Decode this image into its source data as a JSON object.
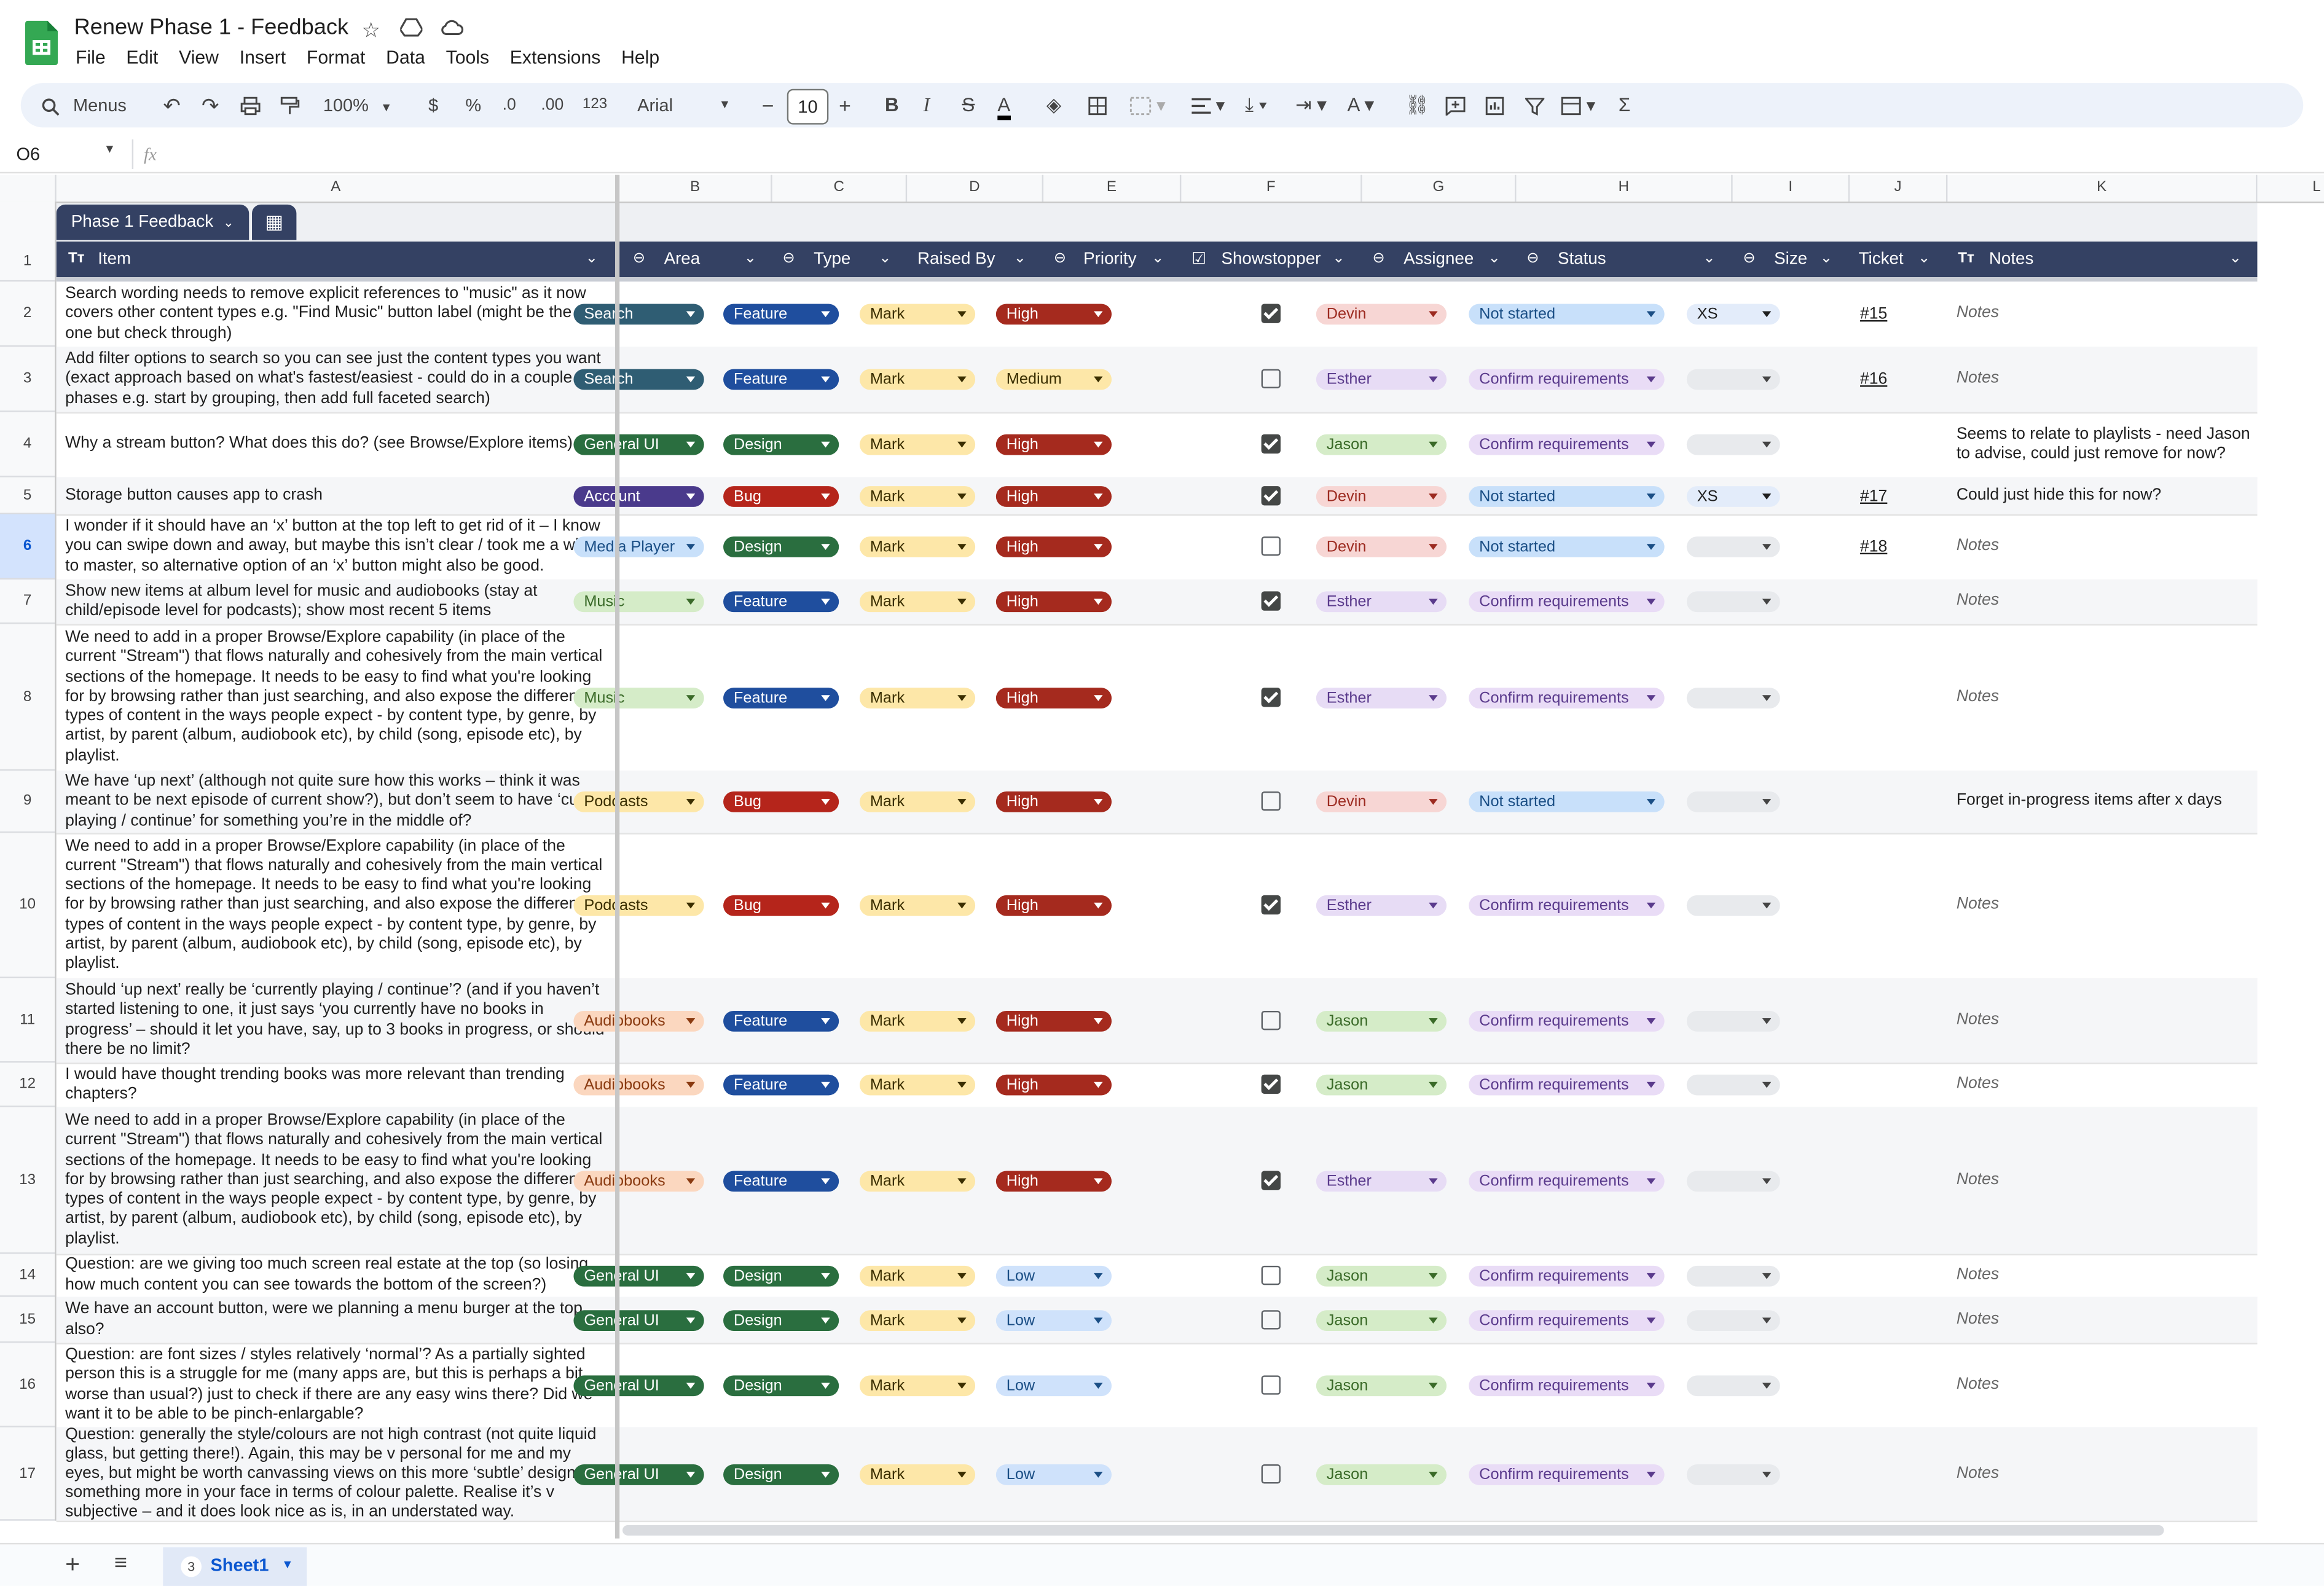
{
  "title": "Renew Phase 1 - Feedback",
  "menu": [
    "File",
    "Edit",
    "View",
    "Insert",
    "Format",
    "Data",
    "Tools",
    "Extensions",
    "Help"
  ],
  "toolbar": {
    "search_label": "Menus",
    "zoom": "100%",
    "currency": "$",
    "percent": "%",
    "dec_less": ".0",
    "dec_more": ".00",
    "fmt_123": "123",
    "font": "Arial",
    "font_size": "10"
  },
  "formula_bar": {
    "cell_ref": "O6",
    "fx": "fx",
    "value": ""
  },
  "columns": [
    "A",
    "B",
    "C",
    "D",
    "E",
    "F",
    "G",
    "H",
    "I",
    "J",
    "K",
    "L"
  ],
  "table": {
    "name": "Phase 1 Feedback",
    "headers": {
      "item": "Item",
      "area": "Area",
      "type": "Type",
      "raised_by": "Raised By",
      "priority": "Priority",
      "showstopper": "Showstopper",
      "assignee": "Assignee",
      "status": "Status",
      "size": "Size",
      "ticket": "Ticket",
      "notes": "Notes"
    }
  },
  "row_numbers": [
    "1",
    "2",
    "3",
    "4",
    "5",
    "6",
    "7",
    "8",
    "9",
    "10",
    "11",
    "12",
    "13",
    "14",
    "15",
    "16",
    "17"
  ],
  "rows": [
    {
      "num": "2",
      "item": "Search wording needs to remove explicit references to \"music\" as it now covers other content types e.g. \"Find Music\" button label (might be the only one but check through)",
      "area": "Search",
      "type": "Feature",
      "raised_by": "Mark",
      "priority": "High",
      "showstopper": true,
      "assignee": "Devin",
      "status": "Not started",
      "size": "XS",
      "ticket": "#15",
      "notes": "Notes",
      "notes_placeholder": true
    },
    {
      "num": "3",
      "item": "Add filter options to search so you can see just the content types you want (exact approach based on what's fastest/easiest - could do in a couple of phases e.g. start by grouping, then add full faceted search)",
      "area": "Search",
      "type": "Feature",
      "raised_by": "Mark",
      "priority": "Medium",
      "showstopper": false,
      "assignee": "Esther",
      "status": "Confirm requirements",
      "size": "",
      "ticket": "#16",
      "notes": "Notes",
      "notes_placeholder": true
    },
    {
      "num": "4",
      "item": "Why a stream button? What does this do? (see Browse/Explore items)",
      "area": "General UI",
      "type": "Design",
      "raised_by": "Mark",
      "priority": "High",
      "showstopper": true,
      "assignee": "Jason",
      "status": "Confirm requirements",
      "size": "",
      "ticket": "",
      "notes": "Seems to relate to playlists - need Jason to advise, could just remove for now?",
      "notes_placeholder": false
    },
    {
      "num": "5",
      "item": "Storage button causes app to crash",
      "area": "Account",
      "type": "Bug",
      "raised_by": "Mark",
      "priority": "High",
      "showstopper": true,
      "assignee": "Devin",
      "status": "Not started",
      "size": "XS",
      "ticket": "#17",
      "notes": "Could just hide this for now?",
      "notes_placeholder": false
    },
    {
      "num": "6",
      "item": "I wonder if it should have an ‘x’ button at the top left to get rid of it – I know you can swipe down and away, but maybe this isn’t clear / took me a while to master, so alternative option of an ‘x’ button might also be good.",
      "area": "Media Player",
      "type": "Design",
      "raised_by": "Mark",
      "priority": "High",
      "showstopper": false,
      "assignee": "Devin",
      "status": "Not started",
      "size": "",
      "ticket": "#18",
      "notes": "Notes",
      "notes_placeholder": true
    },
    {
      "num": "7",
      "item": "Show new items at album level for music and audiobooks (stay at child/episode level for podcasts); show most recent 5 items",
      "area": "Music",
      "type": "Feature",
      "raised_by": "Mark",
      "priority": "High",
      "showstopper": true,
      "assignee": "Esther",
      "status": "Confirm requirements",
      "size": "",
      "ticket": "",
      "notes": "Notes",
      "notes_placeholder": true
    },
    {
      "num": "8",
      "item": "We need to add in a proper Browse/Explore capability (in place of the current \"Stream\") that flows naturally and cohesively from the main vertical sections of the homepage. It needs to be easy to find what you're looking for by browsing rather than just searching, and also expose the different types of content in the ways people expect - by content type, by genre, by artist, by parent (album, audiobook etc), by child (song, episode etc), by playlist.",
      "area": "Music",
      "type": "Feature",
      "raised_by": "Mark",
      "priority": "High",
      "showstopper": true,
      "assignee": "Esther",
      "status": "Confirm requirements",
      "size": "",
      "ticket": "",
      "notes": "Notes",
      "notes_placeholder": true
    },
    {
      "num": "9",
      "item": "We have ‘up next’ (although not quite sure how this works – think it was meant to be next episode of current show?), but don’t seem to have ‘current playing / continue’ for something you’re in the middle of?",
      "area": "Podcasts",
      "type": "Bug",
      "raised_by": "Mark",
      "priority": "High",
      "showstopper": false,
      "assignee": "Devin",
      "status": "Not started",
      "size": "",
      "ticket": "",
      "notes": "Forget in-progress items after x days",
      "notes_placeholder": false
    },
    {
      "num": "10",
      "item": "We need to add in a proper Browse/Explore capability (in place of the current \"Stream\") that flows naturally and cohesively from the main vertical sections of the homepage. It needs to be easy to find what you're looking for by browsing rather than just searching, and also expose the different types of content in the ways people expect - by content type, by genre, by artist, by parent (album, audiobook etc), by child (song, episode etc), by playlist.",
      "area": "Podcasts",
      "type": "Bug",
      "raised_by": "Mark",
      "priority": "High",
      "showstopper": true,
      "assignee": "Esther",
      "status": "Confirm requirements",
      "size": "",
      "ticket": "",
      "notes": "Notes",
      "notes_placeholder": true
    },
    {
      "num": "11",
      "item": "Should ‘up next’ really be ‘currently playing / continue’? (and if you haven’t started listening to one, it just says ‘you currently have no books in progress’ – should it let you have, say, up to 3 books in progress, or should there be no limit?",
      "area": "Audiobooks",
      "type": "Feature",
      "raised_by": "Mark",
      "priority": "High",
      "showstopper": false,
      "assignee": "Jason",
      "status": "Confirm requirements",
      "size": "",
      "ticket": "",
      "notes": "Notes",
      "notes_placeholder": true
    },
    {
      "num": "12",
      "item": "I would have thought trending books was more relevant than trending chapters?",
      "area": "Audiobooks",
      "type": "Feature",
      "raised_by": "Mark",
      "priority": "High",
      "showstopper": true,
      "assignee": "Jason",
      "status": "Confirm requirements",
      "size": "",
      "ticket": "",
      "notes": "Notes",
      "notes_placeholder": true
    },
    {
      "num": "13",
      "item": "We need to add in a proper Browse/Explore capability (in place of the current \"Stream\") that flows naturally and cohesively from the main vertical sections of the homepage. It needs to be easy to find what you're looking for by browsing rather than just searching, and also expose the different types of content in the ways people expect - by content type, by genre, by artist, by parent (album, audiobook etc), by child (song, episode etc), by playlist.",
      "area": "Audiobooks",
      "type": "Feature",
      "raised_by": "Mark",
      "priority": "High",
      "showstopper": true,
      "assignee": "Esther",
      "status": "Confirm requirements",
      "size": "",
      "ticket": "",
      "notes": "Notes",
      "notes_placeholder": true
    },
    {
      "num": "14",
      "item": "Question: are we giving too much screen real estate at the top (so losing how much content you can see towards the bottom of the screen?)",
      "area": "General UI",
      "type": "Design",
      "raised_by": "Mark",
      "priority": "Low",
      "showstopper": false,
      "assignee": "Jason",
      "status": "Confirm requirements",
      "size": "",
      "ticket": "",
      "notes": "Notes",
      "notes_placeholder": true
    },
    {
      "num": "15",
      "item": "We have an account button, were we planning a menu burger at the top also?",
      "area": "General UI",
      "type": "Design",
      "raised_by": "Mark",
      "priority": "Low",
      "showstopper": false,
      "assignee": "Jason",
      "status": "Confirm requirements",
      "size": "",
      "ticket": "",
      "notes": "Notes",
      "notes_placeholder": true
    },
    {
      "num": "16",
      "item": "Question: are font sizes / styles relatively ‘normal’? As a partially sighted person this is a struggle for me (many apps are, but this is perhaps a bit worse than usual?) just to check if there are any easy wins there? Did we want it to be able to be pinch-enlargable?",
      "area": "General UI",
      "type": "Design",
      "raised_by": "Mark",
      "priority": "Low",
      "showstopper": false,
      "assignee": "Jason",
      "status": "Confirm requirements",
      "size": "",
      "ticket": "",
      "notes": "Notes",
      "notes_placeholder": true
    },
    {
      "num": "17",
      "item": "Question: generally the style/colours are not high contrast (not quite liquid glass, but getting there!). Again, this may be v personal for me and my eyes, but might be worth canvassing views on this more ‘subtle’ design vsd something more in your face in terms of colour palette. Realise it’s v subjective – and it does look nice as is, in an understated way.",
      "area": "General UI",
      "type": "Design",
      "raised_by": "Mark",
      "priority": "Low",
      "showstopper": false,
      "assignee": "Jason",
      "status": "Confirm requirements",
      "size": "",
      "ticket": "",
      "notes": "Notes",
      "notes_placeholder": true
    }
  ],
  "sheet_tab": {
    "count": "3",
    "name": "Sheet1"
  },
  "chip_colors": {
    "Search": {
      "bg": "#2f5d73",
      "fg": "#ffffff"
    },
    "General UI": {
      "bg": "#2a6e3f",
      "fg": "#ffffff"
    },
    "Account": {
      "bg": "#4a3a8c",
      "fg": "#ffffff"
    },
    "Media Player": {
      "bg": "#c8e0fa",
      "fg": "#1a4e85"
    },
    "Music": {
      "bg": "#d5ecc8",
      "fg": "#3a6a28"
    },
    "Podcasts": {
      "bg": "#fde7a8",
      "fg": "#3a2e00"
    },
    "Audiobooks": {
      "bg": "#fbd7bf",
      "fg": "#8a3a10"
    },
    "Feature": {
      "bg": "#1f4e9e",
      "fg": "#ffffff"
    },
    "Design": {
      "bg": "#2a6e3f",
      "fg": "#ffffff"
    },
    "Bug": {
      "bg": "#b5251b",
      "fg": "#ffffff"
    },
    "Mark": {
      "bg": "#fde7a8",
      "fg": "#3a2e00"
    },
    "High": {
      "bg": "#a52a1e",
      "fg": "#ffffff"
    },
    "Medium": {
      "bg": "#fde7a8",
      "fg": "#3a2e00"
    },
    "Low": {
      "bg": "#cfe2fb",
      "fg": "#1a4e85"
    },
    "Devin": {
      "bg": "#f7d6d4",
      "fg": "#9c2a20"
    },
    "Esther": {
      "bg": "#e7dcf5",
      "fg": "#5a3a8c"
    },
    "Jason": {
      "bg": "#d5ecc8",
      "fg": "#3a6a28"
    },
    "Not started": {
      "bg": "#c8e0fa",
      "fg": "#1a4e85"
    },
    "Confirm requirements": {
      "bg": "#e9dcf6",
      "fg": "#5a3a8c"
    },
    "XS": {
      "bg": "#e3ecfa",
      "fg": "#1f1f1f"
    },
    "": {
      "bg": "#e8eaed",
      "fg": "#444444"
    }
  }
}
